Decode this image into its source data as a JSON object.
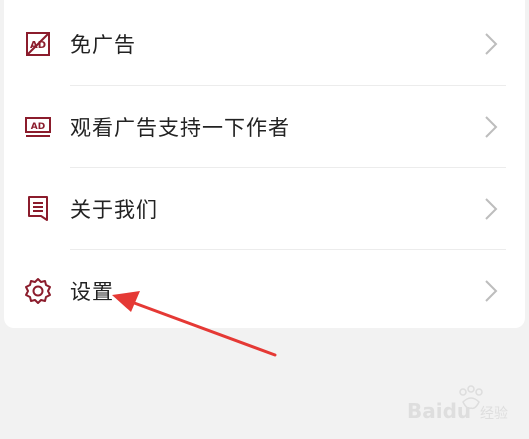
{
  "menu": {
    "items": [
      {
        "label": "免广告",
        "icon": "no-ad-icon"
      },
      {
        "label": "观看广告支持一下作者",
        "icon": "ad-icon"
      },
      {
        "label": "关于我们",
        "icon": "document-icon"
      },
      {
        "label": "设置",
        "icon": "gear-icon"
      }
    ]
  },
  "colors": {
    "icon": "#8b1c2c",
    "arrow": "#e53935",
    "chevron": "#bdbdbd",
    "text": "#222222",
    "background": "#f2f2f2"
  },
  "watermark": {
    "brand": "Baidu",
    "suffix": "经验"
  }
}
